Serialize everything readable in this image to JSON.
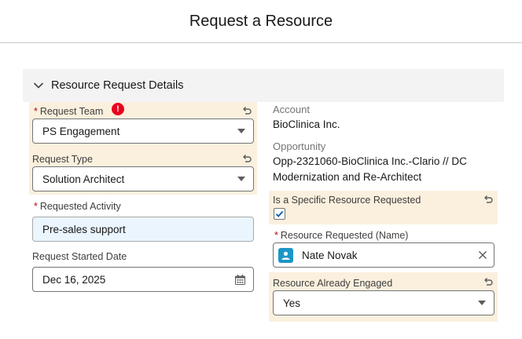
{
  "modal": {
    "title": "Request a Resource"
  },
  "section": {
    "title": "Resource Request Details"
  },
  "left": {
    "request_team": {
      "label": "Request Team",
      "required_mark": "*",
      "value": "PS Engagement",
      "error_mark": "!"
    },
    "request_type": {
      "label": "Request Type",
      "value": "Solution Architect"
    },
    "requested_activity": {
      "label": "Requested Activity",
      "required_mark": "*",
      "value": "Pre-sales support"
    },
    "request_started_date": {
      "label": "Request Started Date",
      "value": "Dec 16, 2025"
    }
  },
  "right": {
    "account": {
      "label": "Account",
      "value": "BioClinica Inc."
    },
    "opportunity": {
      "label": "Opportunity",
      "value_line1": "Opp-2321060-BioClinica Inc.-Clario // DC",
      "value_line2": "Modernization and Re-Architect"
    },
    "specific_resource": {
      "label": "Is a Specific Resource Requested",
      "checked": true
    },
    "resource_requested": {
      "label": "Resource Requested (Name)",
      "required_mark": "*",
      "value": "Nate Novak"
    },
    "already_engaged": {
      "label": "Resource Already Engaged",
      "value": "Yes"
    }
  },
  "icons": {
    "chevron": "chevron-down-icon",
    "undo": "undo-icon",
    "error": "error-icon",
    "caret": "caret-down-icon",
    "calendar": "calendar-icon",
    "user": "user-icon",
    "clear": "close-icon"
  },
  "colors": {
    "highlight": "#fbf0de",
    "required": "#ba0517",
    "error": "#ea001e",
    "avatar": "#1b96c7",
    "filled_input": "#eaf5fe"
  }
}
